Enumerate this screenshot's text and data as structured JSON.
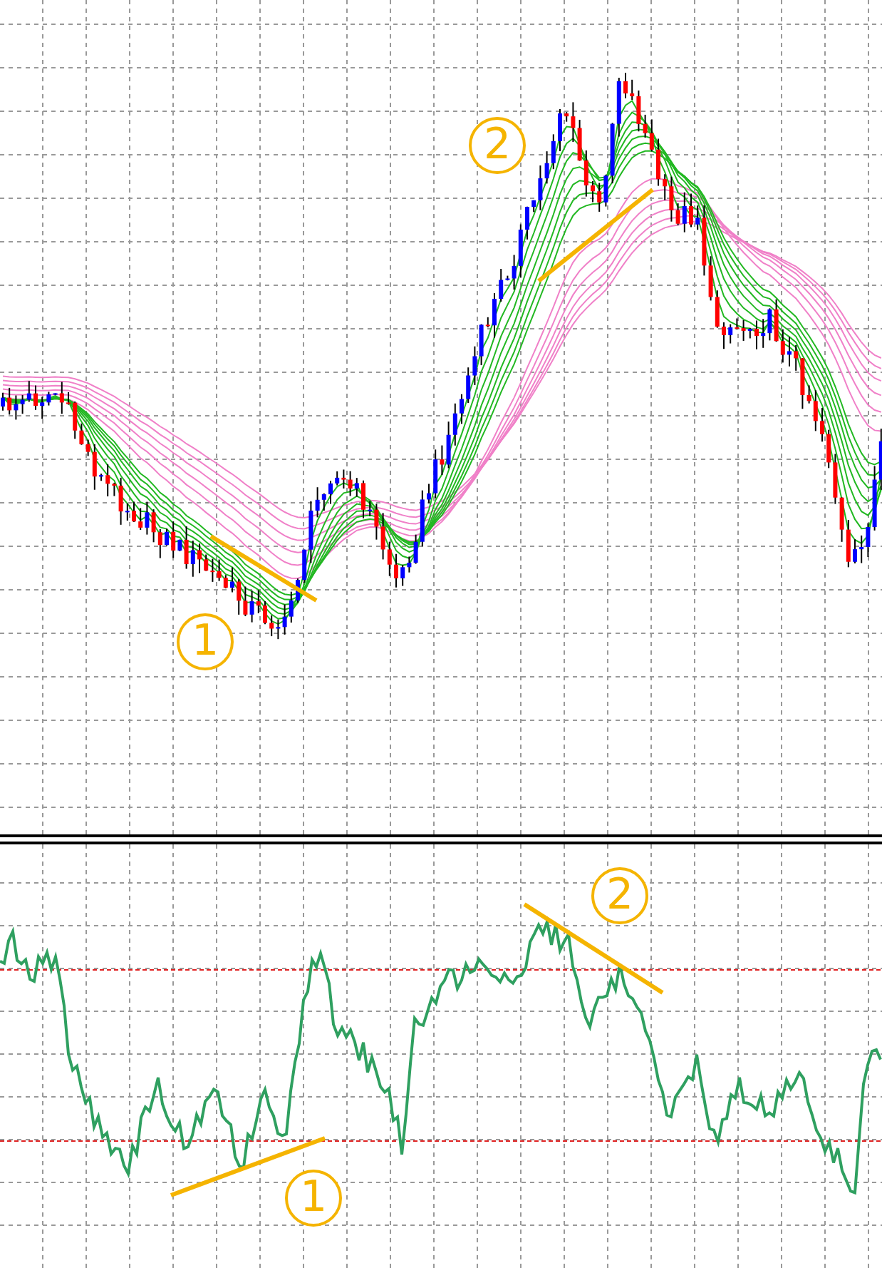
{
  "price_chart": {
    "annotations": [
      {
        "label": "2"
      },
      {
        "label": "1"
      }
    ]
  },
  "oscillator": {
    "annotations": [
      {
        "label": "2"
      },
      {
        "label": "1"
      }
    ]
  }
}
